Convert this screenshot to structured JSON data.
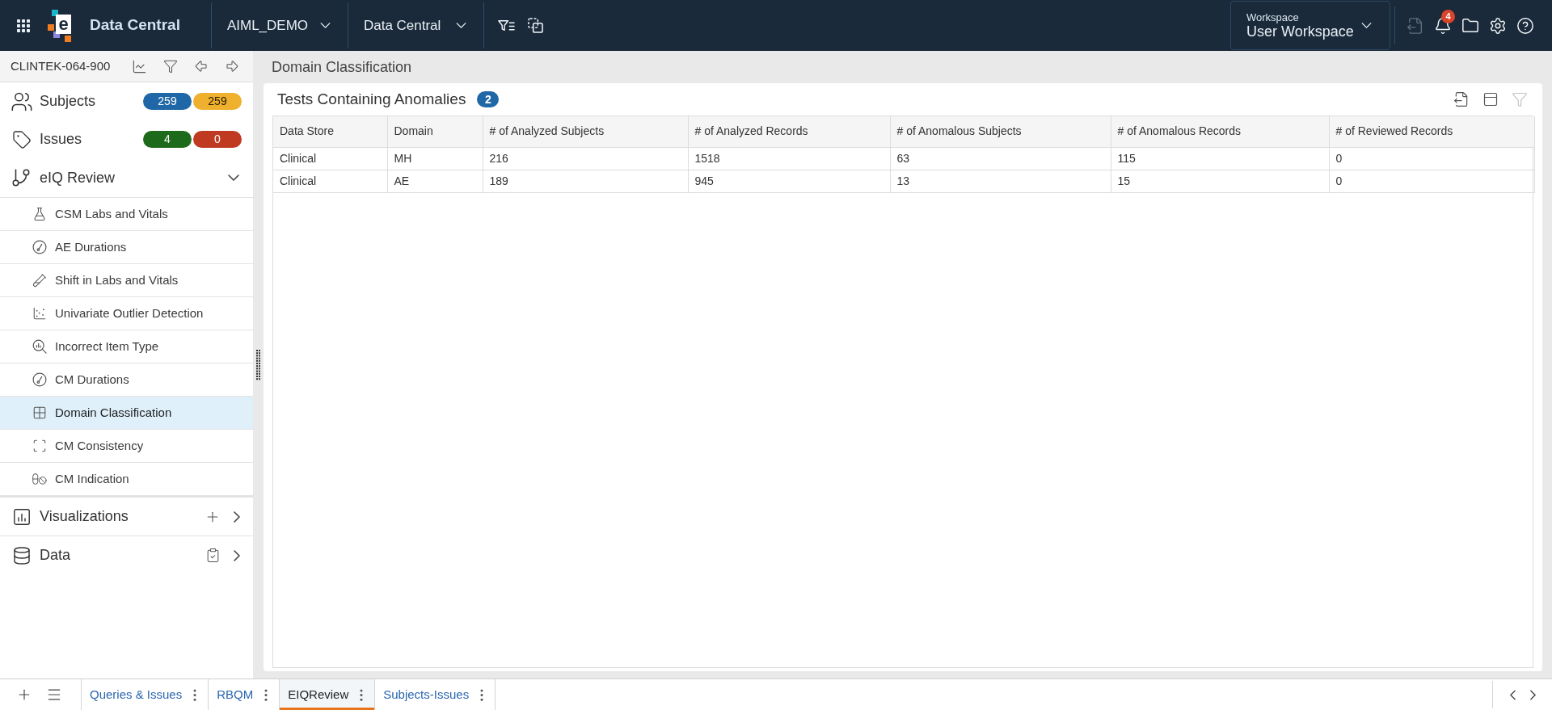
{
  "top_bar": {
    "logo_mark": "e",
    "app_title": "Data Central",
    "selectors": [
      {
        "value": "AIML_DEMO"
      },
      {
        "value": "Data Central"
      }
    ],
    "workspace": {
      "label": "Workspace",
      "value": "User Workspace"
    },
    "actions": [
      {
        "kind": "export",
        "disabled": true
      },
      {
        "kind": "notifications",
        "disabled": false,
        "badge": "4"
      },
      {
        "kind": "folder",
        "disabled": false
      },
      {
        "kind": "settings",
        "disabled": false
      },
      {
        "kind": "help",
        "disabled": false
      }
    ]
  },
  "sidebar": {
    "study": "CLINTEK-064-900",
    "sections": [
      {
        "kind": "counts",
        "label": "Subjects",
        "badges": [
          {
            "text": "259",
            "color": "#1f67a6"
          },
          {
            "text": "259",
            "color": "#efb02e"
          }
        ]
      },
      {
        "kind": "counts",
        "label": "Issues",
        "badges": [
          {
            "text": "4",
            "color": "#1e6a1b"
          },
          {
            "text": "0",
            "color": "#c03a22"
          }
        ]
      },
      {
        "kind": "group",
        "label": "eIQ Review",
        "expanded": true,
        "children": [
          {
            "label": "CSM Labs and Vitals",
            "selected": false
          },
          {
            "label": "AE Durations",
            "selected": false
          },
          {
            "label": "Shift in Labs and Vitals",
            "selected": false
          },
          {
            "label": "Univariate Outlier Detection",
            "selected": false
          },
          {
            "label": "Incorrect Item Type",
            "selected": false
          },
          {
            "label": "CM Durations",
            "selected": false
          },
          {
            "label": "Domain Classification",
            "selected": true
          },
          {
            "label": "CM Consistency",
            "selected": false
          },
          {
            "label": "CM Indication",
            "selected": false
          }
        ]
      },
      {
        "kind": "link",
        "label": "Visualizations",
        "expanded": false
      },
      {
        "kind": "link",
        "label": "Data",
        "expanded": false
      }
    ]
  },
  "main": {
    "page_title": "Domain Classification",
    "card": {
      "title": "Tests Containing Anomalies",
      "count": "2",
      "tools": [
        {
          "kind": "export",
          "disabled": false
        },
        {
          "kind": "layout",
          "disabled": false
        },
        {
          "kind": "filter",
          "disabled": true
        }
      ],
      "table": {
        "columns": [
          "Data Store",
          "Domain",
          "# of Analyzed Subjects",
          "# of Analyzed Records",
          "# of Anomalous Subjects",
          "# of Anomalous Records",
          "# of Reviewed Records"
        ],
        "rows": [
          [
            "Clinical",
            "MH",
            "216",
            "1518",
            "63",
            "115",
            "0"
          ],
          [
            "Clinical",
            "AE",
            "189",
            "945",
            "13",
            "15",
            "0"
          ]
        ]
      }
    }
  },
  "bottom_bar": {
    "tabs": [
      {
        "label": "Queries & Issues",
        "selected": false
      },
      {
        "label": "RBQM",
        "selected": false
      },
      {
        "label": "EIQReview",
        "selected": true
      },
      {
        "label": "Subjects-Issues",
        "selected": false
      }
    ]
  }
}
